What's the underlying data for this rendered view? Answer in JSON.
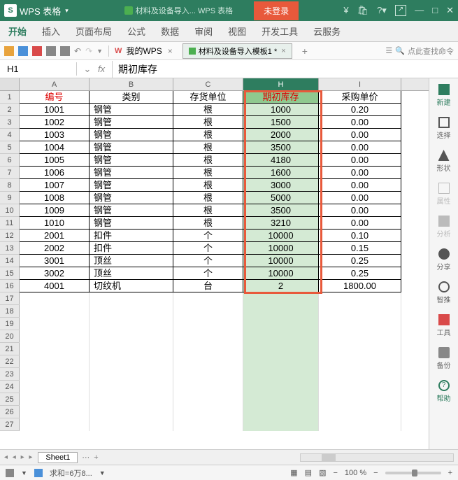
{
  "app": {
    "name": "WPS 表格",
    "doc_preview": "材料及设备导入... WPS 表格",
    "login": "未登录"
  },
  "tabs": [
    "开始",
    "插入",
    "页面布局",
    "公式",
    "数据",
    "审阅",
    "视图",
    "开发工具",
    "云服务"
  ],
  "toolbar": {
    "mywps": "我的WPS",
    "filetab": "材料及设备导入模板1 *",
    "search_ph": "点此查找命令"
  },
  "cellref": {
    "name": "H1",
    "value": "期初库存"
  },
  "cols": [
    "A",
    "B",
    "C",
    "H",
    "I"
  ],
  "headers": {
    "a": "编号",
    "b": "类别",
    "c": "存货单位",
    "h": "期初库存",
    "i": "采购单价"
  },
  "chart_data": {
    "type": "table",
    "columns": [
      "编号",
      "类别",
      "存货单位",
      "期初库存",
      "采购单价"
    ],
    "rows": [
      [
        "1001",
        "钢管",
        "根",
        "1000",
        "0.20"
      ],
      [
        "1002",
        "钢管",
        "根",
        "1500",
        "0.00"
      ],
      [
        "1003",
        "钢管",
        "根",
        "2000",
        "0.00"
      ],
      [
        "1004",
        "钢管",
        "根",
        "3500",
        "0.00"
      ],
      [
        "1005",
        "钢管",
        "根",
        "4180",
        "0.00"
      ],
      [
        "1006",
        "钢管",
        "根",
        "1600",
        "0.00"
      ],
      [
        "1007",
        "钢管",
        "根",
        "3000",
        "0.00"
      ],
      [
        "1008",
        "钢管",
        "根",
        "5000",
        "0.00"
      ],
      [
        "1009",
        "钢管",
        "根",
        "3500",
        "0.00"
      ],
      [
        "1010",
        "钢管",
        "根",
        "3210",
        "0.00"
      ],
      [
        "2001",
        "扣件",
        "个",
        "10000",
        "0.10"
      ],
      [
        "2002",
        "扣件",
        "个",
        "10000",
        "0.15"
      ],
      [
        "3001",
        "顶丝",
        "个",
        "10000",
        "0.25"
      ],
      [
        "3002",
        "顶丝",
        "个",
        "10000",
        "0.25"
      ],
      [
        "4001",
        "切纹机",
        "台",
        "2",
        "1800.00"
      ]
    ]
  },
  "side": [
    {
      "k": "new",
      "t": "新建",
      "c": "g"
    },
    {
      "k": "sel",
      "t": "选择",
      "c": ""
    },
    {
      "k": "shape",
      "t": "形状",
      "c": ""
    },
    {
      "k": "prop",
      "t": "属性",
      "c": "d"
    },
    {
      "k": "ana",
      "t": "分析",
      "c": "d"
    },
    {
      "k": "share",
      "t": "分享",
      "c": ""
    },
    {
      "k": "smart",
      "t": "智推",
      "c": ""
    },
    {
      "k": "tool",
      "t": "工具",
      "c": ""
    },
    {
      "k": "bak",
      "t": "备份",
      "c": ""
    },
    {
      "k": "help",
      "t": "帮助",
      "c": "g"
    }
  ],
  "sheet": "Sheet1",
  "status": {
    "sum": "求和=6万8...",
    "zoom": "100 %"
  }
}
